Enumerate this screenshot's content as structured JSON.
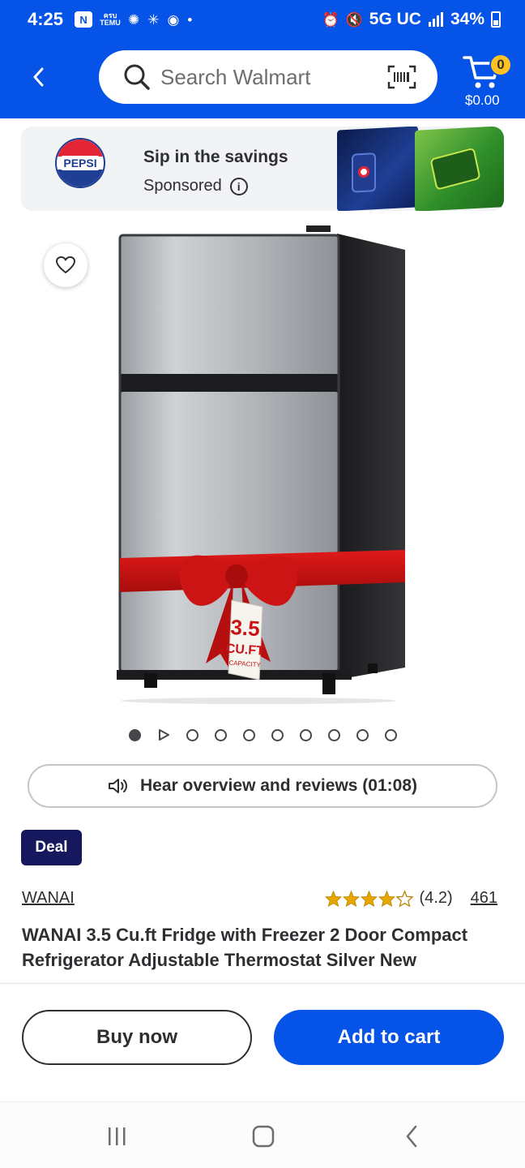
{
  "status_bar": {
    "time": "4:25",
    "temu_label": "ครบ\nTEMU",
    "network": "5G UC",
    "battery": "34%"
  },
  "header": {
    "search_placeholder": "Search Walmart",
    "cart_count": "0",
    "cart_total": "$0.00"
  },
  "ad": {
    "brand_logo": "PEPSI",
    "title": "Sip in the savings",
    "sponsored_label": "Sponsored",
    "info_icon": "i"
  },
  "hero": {
    "image_count": 10,
    "active_index": 0,
    "video_index": 1
  },
  "audio": {
    "label": "Hear overview and reviews (01:08)"
  },
  "deal": {
    "label": "Deal"
  },
  "product": {
    "brand": "WANAI",
    "rating_value": 4.2,
    "rating_text": "(4.2)",
    "review_count": "461",
    "title": "WANAI 3.5 Cu.ft Fridge with Freezer 2 Door Compact Refrigerator Adjustable Thermostat Silver New"
  },
  "actions": {
    "buy_now": "Buy now",
    "add_to_cart": "Add to cart"
  },
  "colors": {
    "walmart_blue": "#0653e8",
    "spark_yellow": "#ffc220",
    "deal_navy": "#16185e",
    "star_gold": "#e6a700"
  },
  "icons": {
    "back": "chevron-left-icon",
    "search": "search-icon",
    "scan": "barcode-scan-icon",
    "cart": "cart-icon",
    "favorite": "heart-icon",
    "audio": "speaker-icon"
  }
}
